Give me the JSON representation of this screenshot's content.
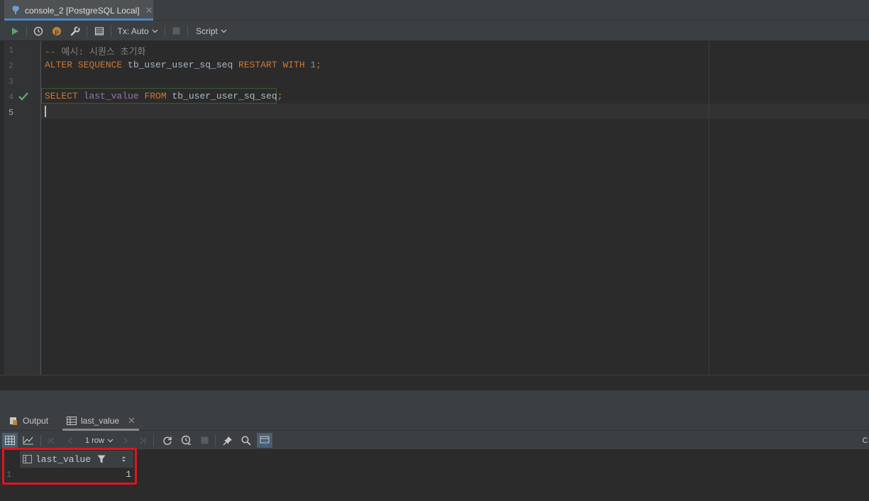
{
  "editor_tab": {
    "title": "console_2 [PostgreSQL Local]",
    "close": "✕"
  },
  "toolbar": {
    "tx_label": "Tx: Auto",
    "script_label": "Script"
  },
  "editor": {
    "line_numbers": [
      "1",
      "2",
      "3",
      "4",
      "5"
    ],
    "line1": {
      "comment": "-- 예시: 시퀀스 초기화"
    },
    "line2": {
      "kw1": "ALTER SEQUENCE",
      "ident": " tb_user_user_sq_seq ",
      "kw2": "RESTART WITH",
      "num": " 1",
      "end": ";"
    },
    "line4": {
      "kw1": "SELECT",
      "col": " last_value ",
      "kw2": "FROM",
      "ident": " tb_user_user_sq_seq",
      "end": ";"
    }
  },
  "services": {
    "output_tab": "Output",
    "result_tab": "last_value"
  },
  "result_toolbar": {
    "rows_label": "1 row"
  },
  "results": {
    "column_header": "last_value",
    "row_number": "1",
    "cell_value": "1"
  },
  "right_edge_text": "C",
  "colors": {
    "accent": "#4a88c7",
    "run_green": "#59a869",
    "highlight": "#e0141e",
    "keyword": "#cc7832",
    "number": "#6897bb"
  }
}
